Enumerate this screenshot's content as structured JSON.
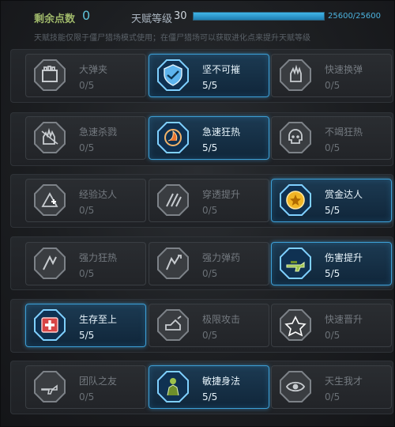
{
  "header": {
    "points_label": "剩余点数",
    "points_value": "0",
    "level_label": "天赋等级",
    "level_value": "30",
    "xp_text": "25600/25600",
    "xp_progress": 1.0,
    "note": "天赋技能仅限于僵尸猎场模式使用；在僵尸猎场可以获取进化点来提升天赋等级"
  },
  "colors": {
    "active_border": "#3d9fd6",
    "points_value": "#5ec1d8",
    "xp_fill": "#41b6e8"
  },
  "talents": [
    [
      {
        "name": "大弹夹",
        "level": "0/5",
        "active": false,
        "icon": "ammo-crate-icon"
      },
      {
        "name": "坚不可摧",
        "level": "5/5",
        "active": true,
        "icon": "shield-icon"
      },
      {
        "name": "快速换弹",
        "level": "0/5",
        "active": false,
        "icon": "hand-reload-icon"
      }
    ],
    [
      {
        "name": "急速杀戮",
        "level": "0/5",
        "active": false,
        "icon": "hand-slash-icon"
      },
      {
        "name": "急速狂热",
        "level": "5/5",
        "active": true,
        "icon": "fire-swirl-icon"
      },
      {
        "name": "不竭狂热",
        "level": "0/5",
        "active": false,
        "icon": "skull-icon"
      }
    ],
    [
      {
        "name": "经验达人",
        "level": "0/5",
        "active": false,
        "icon": "xp-plus-icon"
      },
      {
        "name": "穿透提升",
        "level": "0/5",
        "active": false,
        "icon": "penetration-icon"
      },
      {
        "name": "赏金达人",
        "level": "5/5",
        "active": true,
        "icon": "gold-coin-icon"
      }
    ],
    [
      {
        "name": "强力狂热",
        "level": "0/5",
        "active": false,
        "icon": "power-frenzy-icon"
      },
      {
        "name": "强力弹药",
        "level": "0/5",
        "active": false,
        "icon": "power-ammo-icon"
      },
      {
        "name": "伤害提升",
        "level": "5/5",
        "active": true,
        "icon": "rifle-icon"
      }
    ],
    [
      {
        "name": "生存至上",
        "level": "5/5",
        "active": true,
        "icon": "medkit-icon"
      },
      {
        "name": "极限攻击",
        "level": "0/5",
        "active": false,
        "icon": "extreme-attack-icon"
      },
      {
        "name": "快速晋升",
        "level": "0/5",
        "active": false,
        "icon": "rank-up-icon"
      }
    ],
    [
      {
        "name": "团队之友",
        "level": "0/5",
        "active": false,
        "icon": "team-gun-icon"
      },
      {
        "name": "敏捷身法",
        "level": "5/5",
        "active": true,
        "icon": "soldier-icon"
      },
      {
        "name": "天生我才",
        "level": "0/5",
        "active": false,
        "icon": "eye-icon"
      }
    ]
  ]
}
